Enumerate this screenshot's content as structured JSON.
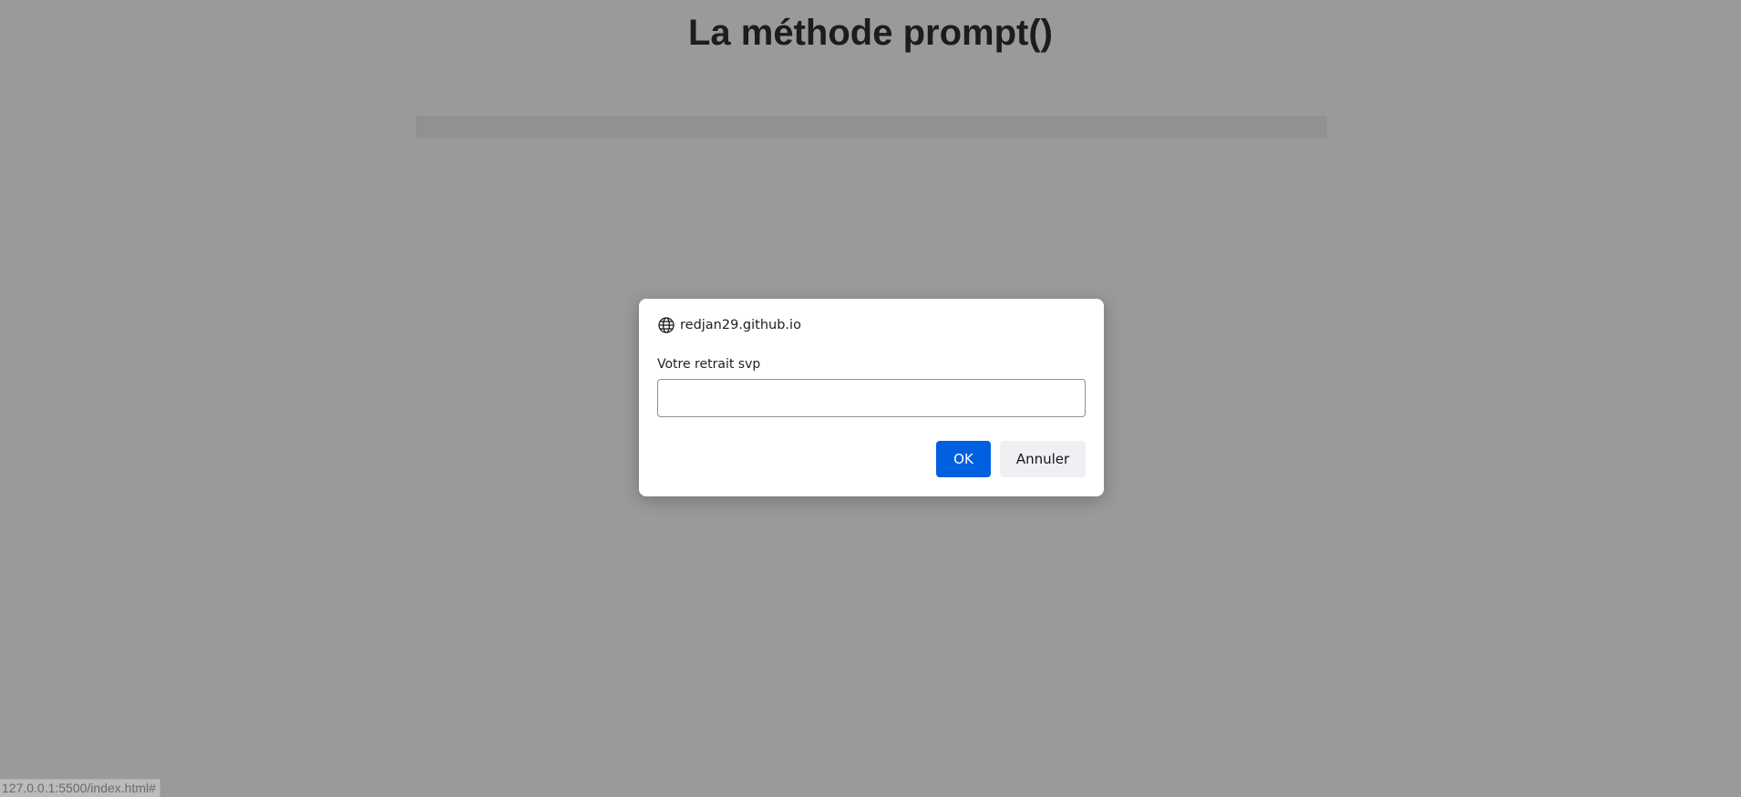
{
  "page": {
    "title": "La méthode prompt()"
  },
  "dialog": {
    "origin": "redjan29.github.io",
    "origin_icon": "globe-icon",
    "message": "Votre retrait svp",
    "input_value": "",
    "ok_label": "OK",
    "cancel_label": "Annuler"
  },
  "status_bar": {
    "url": "127.0.0.1:5500/index.html#"
  },
  "colors": {
    "primary_button": "#0061e0",
    "secondary_button": "#f0f0f4",
    "overlay": "#28282c"
  }
}
